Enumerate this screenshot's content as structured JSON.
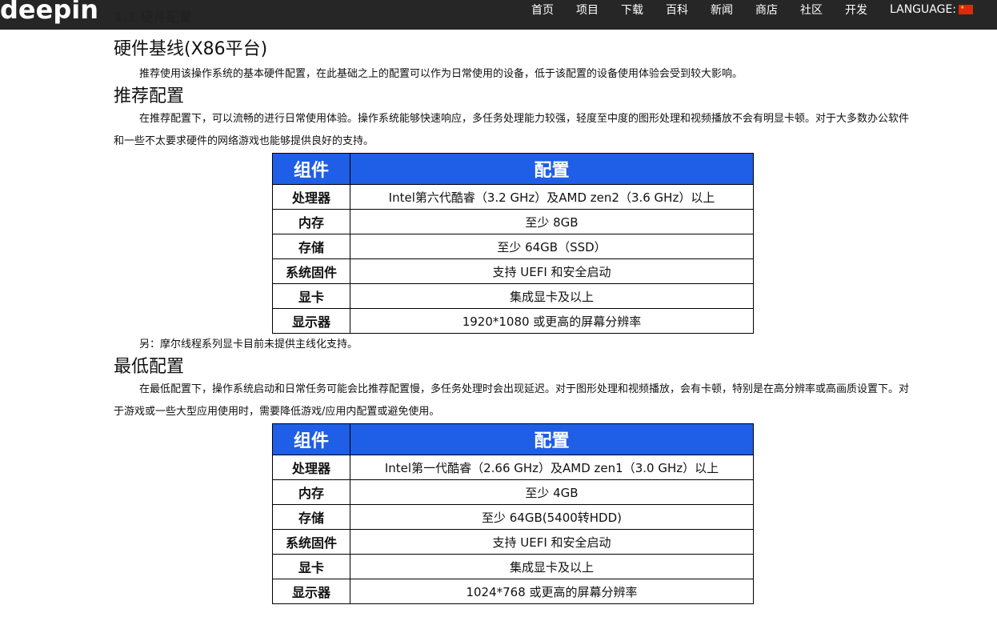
{
  "header": {
    "logo": "deepin",
    "section_crumb": "1.1 硬件配置",
    "nav": [
      "首页",
      "项目",
      "下载",
      "百科",
      "新闻",
      "商店",
      "社区",
      "开发"
    ],
    "language_label": "LANGUAGE:",
    "flag_icon": "china-flag-icon"
  },
  "page": {
    "title": "硬件基线(X86平台)",
    "intro": "推荐使用该操作系统的基本硬件配置，在此基础之上的配置可以作为日常使用的设备，低于该配置的设备使用体验会受到较大影响。",
    "recommended": {
      "heading": "推荐配置",
      "desc": "在推荐配置下，可以流畅的进行日常使用体验。操作系统能够快速响应，多任务处理能力较强，轻度至中度的图形处理和视频播放不会有明显卡顿。对于大多数办公软件和一些不太要求硬件的网络游戏也能够提供良好的支持。",
      "col_component": "组件",
      "col_config": "配置",
      "rows": [
        {
          "k": "处理器",
          "v": "Intel第六代酷睿（3.2 GHz）及AMD zen2（3.6 GHz）以上"
        },
        {
          "k": "内存",
          "v": "至少 8GB"
        },
        {
          "k": "存储",
          "v": "至少 64GB（SSD）"
        },
        {
          "k": "系统固件",
          "v": "支持 UEFI 和安全启动"
        },
        {
          "k": "显卡",
          "v": "集成显卡及以上"
        },
        {
          "k": "显示器",
          "v": "1920*1080 或更高的屏幕分辨率"
        }
      ],
      "note": "另：摩尔线程系列显卡目前未提供主线化支持。"
    },
    "minimum": {
      "heading": "最低配置",
      "desc": "在最低配置下，操作系统启动和日常任务可能会比推荐配置慢，多任务处理时会出现延迟。对于图形处理和视频播放，会有卡顿，特别是在高分辨率或高画质设置下。对于游戏或一些大型应用使用时，需要降低游戏/应用内配置或避免使用。",
      "col_component": "组件",
      "col_config": "配置",
      "rows": [
        {
          "k": "处理器",
          "v": "Intel第一代酷睿（2.66 GHz）及AMD zen1（3.0 GHz）以上"
        },
        {
          "k": "内存",
          "v": "至少 4GB"
        },
        {
          "k": "存储",
          "v": "至少 64GB(5400转HDD)"
        },
        {
          "k": "系统固件",
          "v": "支持 UEFI 和安全启动"
        },
        {
          "k": "显卡",
          "v": "集成显卡及以上"
        },
        {
          "k": "显示器",
          "v": "1024*768 或更高的屏幕分辨率"
        }
      ]
    }
  }
}
